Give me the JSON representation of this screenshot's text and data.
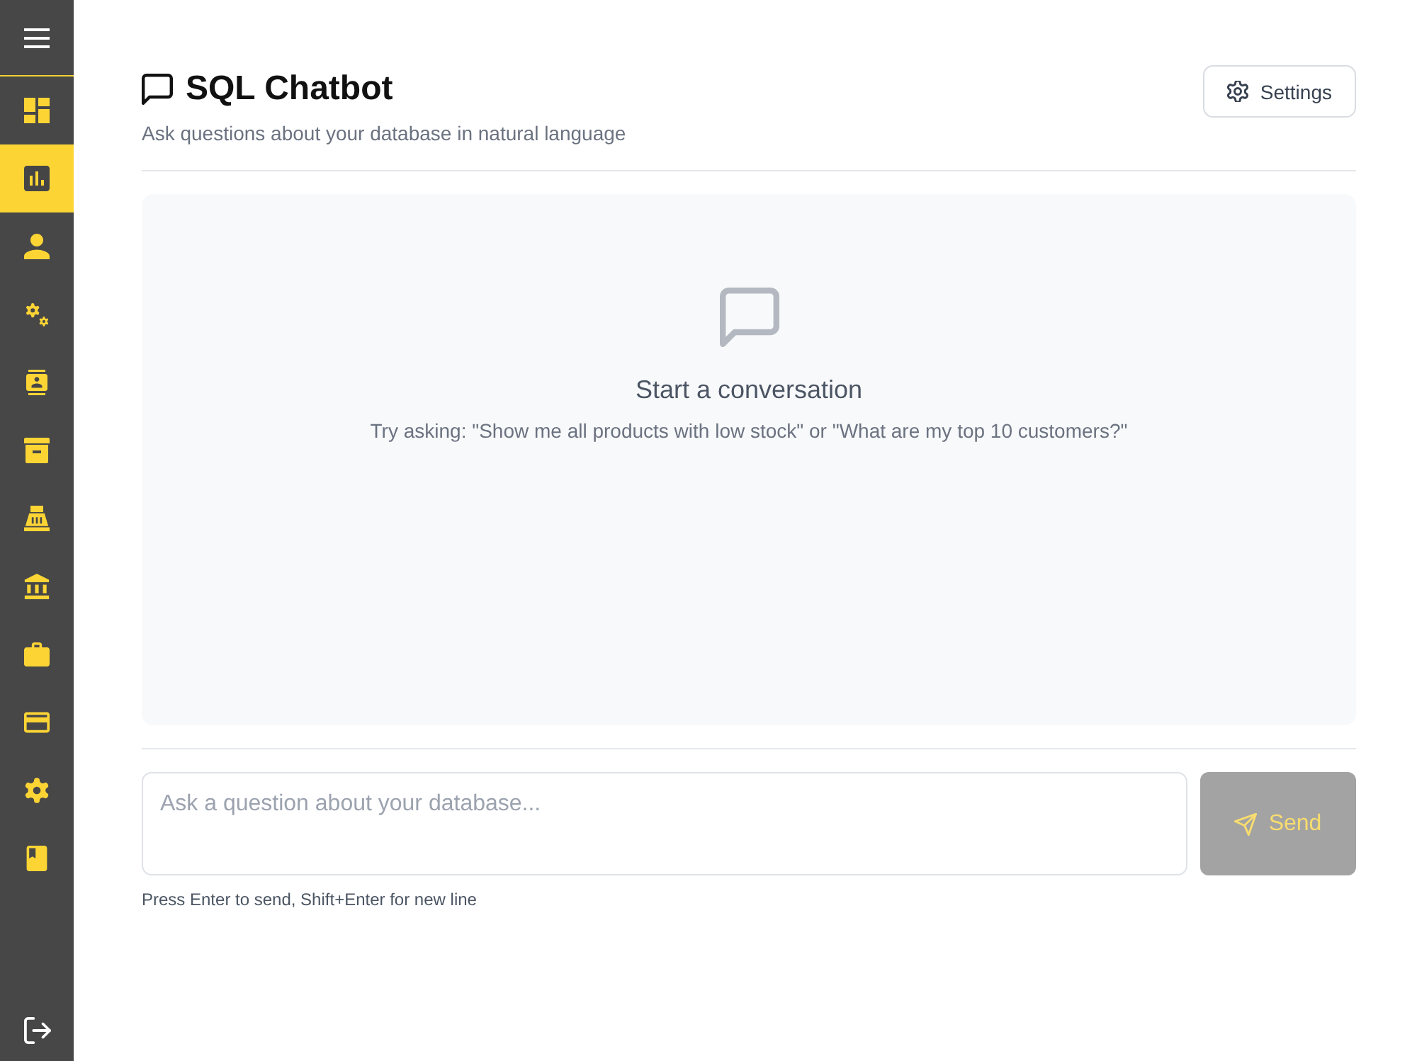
{
  "sidebar": {
    "items": [
      {
        "selected": false
      },
      {
        "selected": true
      },
      {
        "selected": false
      },
      {
        "selected": false
      },
      {
        "selected": false
      },
      {
        "selected": false
      },
      {
        "selected": false
      },
      {
        "selected": false
      },
      {
        "selected": false
      },
      {
        "selected": false
      },
      {
        "selected": false
      },
      {
        "selected": false
      }
    ]
  },
  "header": {
    "title": "SQL Chatbot",
    "subtitle": "Ask questions about your database in natural language",
    "settings_button": "Settings"
  },
  "empty_state": {
    "title": "Start a conversation",
    "hint": "Try asking: \"Show me all products with low stock\" or \"What are my top 10 customers?\""
  },
  "composer": {
    "placeholder": "Ask a question about your database...",
    "send_button": {
      "label": "Send",
      "disabled": true
    },
    "hint": "Press Enter to send, Shift+Enter for new line"
  }
}
